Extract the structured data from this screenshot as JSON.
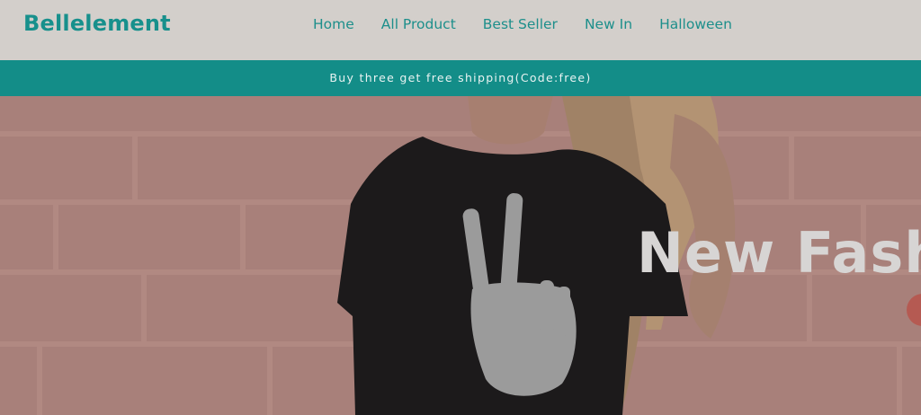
{
  "brand": {
    "name": "Bellelement",
    "accent": "#17908c"
  },
  "nav": {
    "items": [
      {
        "label": "Home"
      },
      {
        "label": "All Product"
      },
      {
        "label": "Best Seller"
      },
      {
        "label": "New In"
      },
      {
        "label": "Halloween"
      }
    ]
  },
  "promo": {
    "text": "Buy three get free shipping(Code:free)",
    "background": "#138d88"
  },
  "hero": {
    "title": "New Fash",
    "image": "woman-in-black-skeleton-peace-hand-tshirt-on-pink-brick-wall",
    "cta_color": "#b55a52"
  }
}
